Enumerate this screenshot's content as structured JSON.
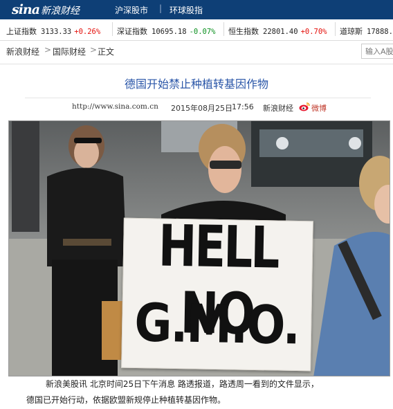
{
  "topnav": {
    "logo_sina": "sina",
    "logo_caijing": "新浪财经",
    "items": [
      "沪深股市",
      "环球股指"
    ],
    "separator": "|"
  },
  "ticker": [
    {
      "name": "上证指数",
      "value": "3133.33",
      "change": "+0.26%",
      "direction": "up"
    },
    {
      "name": "深证指数",
      "value": "10695.18",
      "change": "-0.07%",
      "direction": "down"
    },
    {
      "name": "恒生指数",
      "value": "22801.40",
      "change": "+0.70%",
      "direction": "up"
    },
    {
      "name": "道琼斯",
      "value": "17888.",
      "change": "",
      "direction": "none"
    }
  ],
  "breadcrumb": {
    "items": [
      "新浪财经",
      "国际财经",
      "正文"
    ],
    "arrow": ">"
  },
  "search": {
    "placeholder": "输入A股"
  },
  "article": {
    "title": "德国开始禁止种植转基因作物",
    "url": "http://www.sina.com.cn",
    "date": "2015年08月25日",
    "time": "17:56",
    "source": "新浪财经",
    "weibo_label": "微博",
    "photo_sign_line1": "HELL NO",
    "photo_sign_line2": "G.M.O.",
    "paragraph_line1": "新浪美股讯 北京时间25日下午消息 路透报道，路透周一看到的文件显示，",
    "paragraph_line2": "德国已开始行动，依据欧盟新规停止种植转基因作物。"
  },
  "colors": {
    "nav_bg": "#0e3f76",
    "title_blue": "#2a56a8",
    "up_red": "#e4100b",
    "down_green": "#0a8f1e"
  },
  "icons": [
    "weibo-icon"
  ]
}
